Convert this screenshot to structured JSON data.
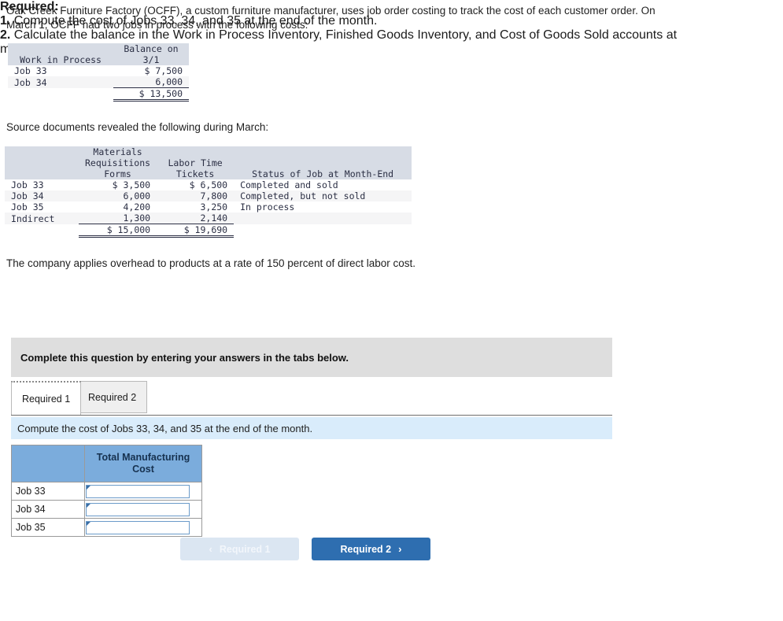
{
  "intro": {
    "paragraph": "Oak Creek Furniture Factory (OCFF), a custom furniture manufacturer, uses job order costing to track the cost of each customer order. On March 1, OCFF had two jobs in process with the following costs:"
  },
  "wip_table": {
    "header": {
      "col1_line1": "",
      "col1_line2": "Work in Process",
      "col2_line1": "Balance on",
      "col2_line2": "3/1"
    },
    "rows": [
      {
        "label": "Job 33",
        "value": "$ 7,500"
      },
      {
        "label": "Job 34",
        "value": "6,000"
      }
    ],
    "total": "$ 13,500"
  },
  "source_doc_line": "Source documents revealed the following during March:",
  "source_table": {
    "header": {
      "c0": "",
      "c1_l1": "Materials",
      "c1_l2": "Requisitions",
      "c1_l3": "Forms",
      "c2_l1": "",
      "c2_l2": "Labor Time",
      "c2_l3": "Tickets",
      "c3_l1": "",
      "c3_l2": "",
      "c3_l3": "Status of Job at Month-End"
    },
    "rows": [
      {
        "label": "Job 33",
        "materials": "$ 3,500",
        "labor": "$ 6,500",
        "status": "Completed and sold"
      },
      {
        "label": "Job 34",
        "materials": "6,000",
        "labor": "7,800",
        "status": "Completed, but not sold"
      },
      {
        "label": "Job 35",
        "materials": "4,200",
        "labor": "3,250",
        "status": "In process"
      },
      {
        "label": "Indirect",
        "materials": "1,300",
        "labor": "2,140",
        "status": ""
      }
    ],
    "totals": {
      "materials": "$ 15,000",
      "labor": "$ 19,690"
    }
  },
  "overhead_line": "The company applies overhead to products at a rate of 150 percent of direct labor cost.",
  "required": {
    "heading": "Required:",
    "items": [
      {
        "num": "1.",
        "text": "Compute the cost of Jobs 33, 34, and 35 at the end of the month."
      },
      {
        "num": "2.",
        "text": "Calculate the balance in the Work in Process Inventory, Finished Goods Inventory, and Cost of Goods Sold accounts at month-end."
      }
    ]
  },
  "instruction_banner": "Complete this question by entering your answers in the tabs below.",
  "tabs": [
    {
      "label": "Required 1",
      "active": true
    },
    {
      "label": "Required 2",
      "active": false
    }
  ],
  "sub_instruction": "Compute the cost of Jobs 33, 34, and 35 at the end of the month.",
  "answer_grid": {
    "header": {
      "blank": "",
      "col": "Total Manufacturing Cost"
    },
    "rows": [
      {
        "label": "Job 33",
        "value": ""
      },
      {
        "label": "Job 34",
        "value": ""
      },
      {
        "label": "Job 35",
        "value": ""
      }
    ]
  },
  "nav": {
    "prev": {
      "label": "Required 1",
      "icon": "chevron-left-icon",
      "glyph": "‹",
      "disabled": true
    },
    "next": {
      "label": "Required 2",
      "icon": "chevron-right-icon",
      "glyph": "›",
      "disabled": false
    }
  },
  "colors": {
    "table_header_bg": "#d7dce5",
    "banner_bg": "#dedede",
    "sub_instruction_bg": "#d9ecfb",
    "grid_header_blue": "#7bacdc",
    "next_button_blue": "#2e6eb0",
    "prev_button_blue": "#dbe6f2",
    "input_border": "#6b9bc9"
  }
}
